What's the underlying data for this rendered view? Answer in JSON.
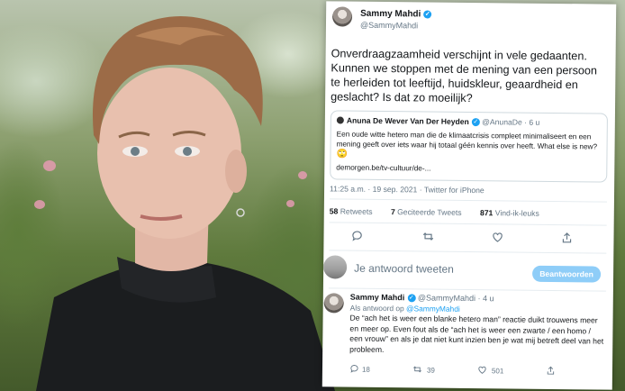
{
  "tweet": {
    "author_name": "Sammy Mahdi",
    "author_handle": "@SammyMahdi",
    "text": "Onverdraagzaamheid verschijnt in vele gedaanten. Kunnen we stoppen met de mening van een persoon te herleiden tot leeftijd, huidskleur, geaardheid en geslacht? Is dat zo moeilijk?",
    "timestamp": "11:25 a.m. · 19 sep. 2021 · Twitter for iPhone",
    "stats": {
      "retweets_count": "58",
      "retweets_label": "Retweets",
      "quotes_count": "7",
      "quotes_label": "Geciteerde Tweets",
      "likes_count": "871",
      "likes_label": "Vind-ik-leuks"
    }
  },
  "quoted_tweet": {
    "author_name": "Anuna De Wever Van Der Heyden",
    "author_handle": "@AnunaDe",
    "age": "· 6 u",
    "text": "Een oude witte hetero man die de klimaatcrisis compleet minimaliseert en een mening geeft over iets waar hij totaal géén kennis over heeft. What else is new?",
    "emoji": "🙄",
    "link": "demorgen.be/tv-cultuur/de-..."
  },
  "reply_box": {
    "placeholder": "Je antwoord tweeten",
    "button_label": "Beantwoorden"
  },
  "reply": {
    "author_name": "Sammy Mahdi",
    "author_handle": "@SammyMahdi",
    "age": "· 4 u",
    "reply_to_prefix": "Als antwoord op",
    "reply_to_handle": "@SammyMahdi",
    "text": "De “ach het is weer een blanke hetero man” reactie duikt trouwens meer en meer op. Even fout als de “ach het is weer een zwarte / een homo / een vrouw” en als je dat niet kunt inzien ben je wat mij betreft deel van het probleem.",
    "reply_count": "18",
    "retweet_count": "39",
    "like_count": "501"
  },
  "colors": {
    "accent": "#1da1f2",
    "button_disabled": "#8ecdf8",
    "secondary_text": "#657786"
  }
}
